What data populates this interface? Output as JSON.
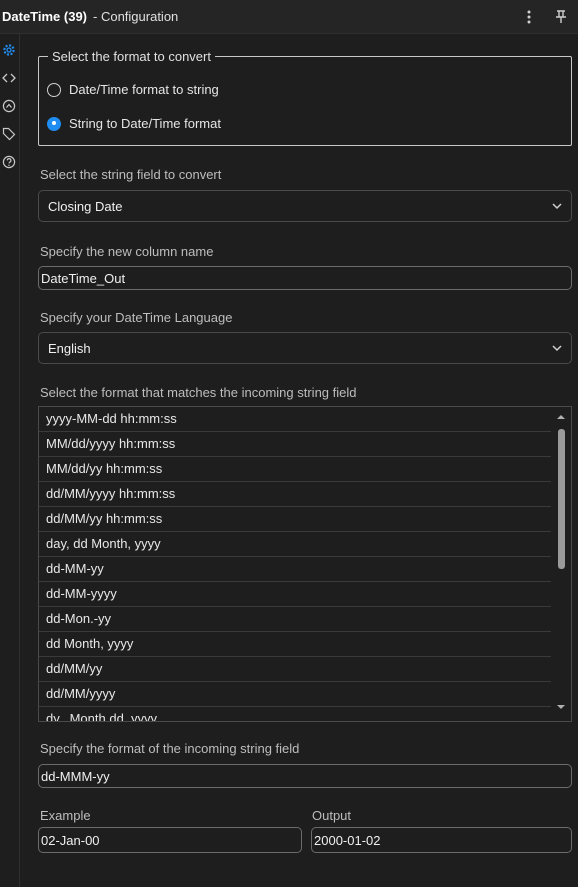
{
  "titlebar": {
    "title": "DateTime (39)",
    "subtitle": "- Configuration",
    "more_icon": "more-vertical-icon",
    "pin_icon": "pin-icon"
  },
  "sidebar": {
    "icons": [
      "gear-icon",
      "code-icon",
      "workflow-icon",
      "tag-icon",
      "help-icon"
    ],
    "active_color": "#1e8cf0"
  },
  "format_group": {
    "legend": "Select the format to convert",
    "options": [
      {
        "label": "Date/Time format to string",
        "selected": false
      },
      {
        "label": "String to Date/Time format",
        "selected": true
      }
    ]
  },
  "string_field": {
    "label": "Select the string field to convert",
    "value": "Closing Date"
  },
  "new_column": {
    "label": "Specify the new column name",
    "value": "DateTime_Out"
  },
  "language": {
    "label": "Specify your DateTime Language",
    "value": "English"
  },
  "format_list": {
    "label": "Select the format that matches the incoming string field",
    "items": [
      "yyyy-MM-dd hh:mm:ss",
      "MM/dd/yyyy hh:mm:ss",
      "MM/dd/yy hh:mm:ss",
      "dd/MM/yyyy hh:mm:ss",
      "dd/MM/yy hh:mm:ss",
      "day, dd Month, yyyy",
      "dd-MM-yy",
      "dd-MM-yyyy",
      "dd-Mon.-yy",
      "dd Month, yyyy",
      "dd/MM/yy",
      "dd/MM/yyyy",
      "dy., Month dd, yyyy"
    ]
  },
  "incoming_format": {
    "label": "Specify the format of the incoming string field",
    "value": "dd-MMM-yy"
  },
  "example": {
    "label": "Example",
    "value": "02-Jan-00"
  },
  "output": {
    "label": "Output",
    "value": "2000-01-02"
  },
  "colors": {
    "accent": "#1e8cf0",
    "background": "#1e1e1e"
  }
}
